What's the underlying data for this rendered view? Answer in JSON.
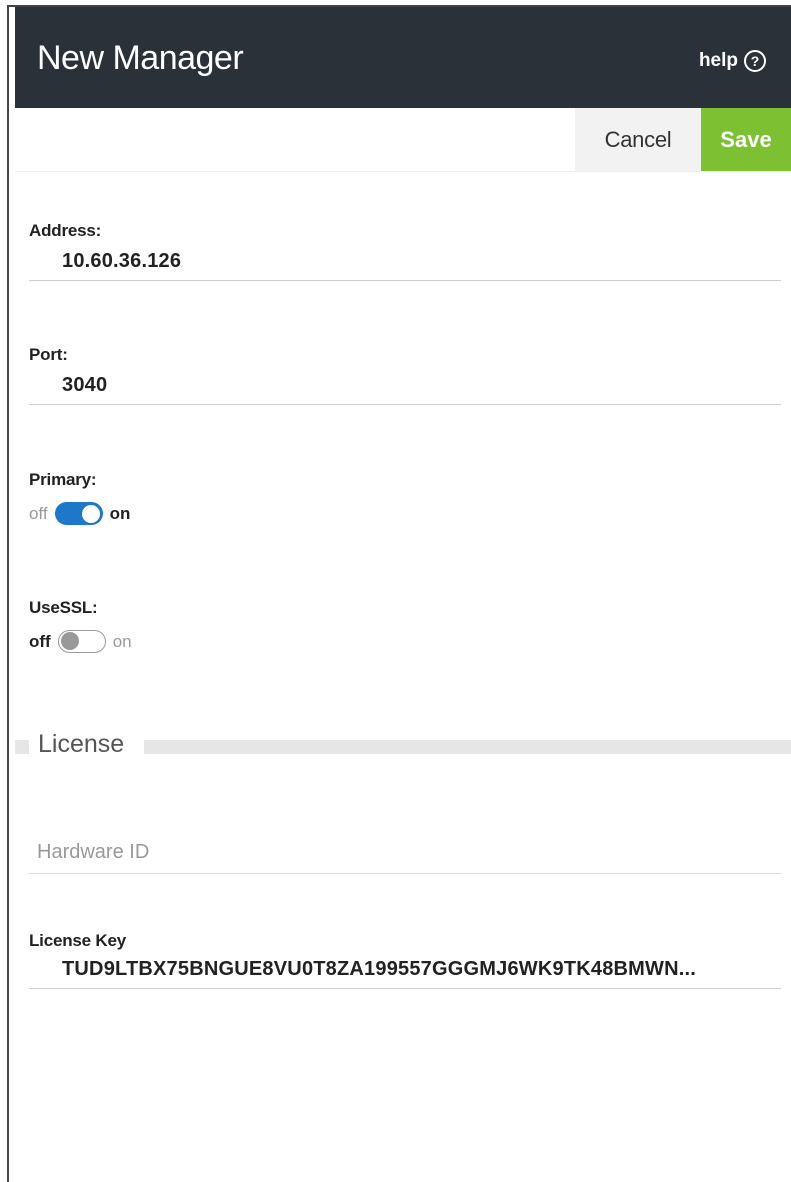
{
  "header": {
    "title": "New Manager",
    "help_label": "help",
    "help_icon": "?"
  },
  "toolbar": {
    "cancel_label": "Cancel",
    "save_label": "Save"
  },
  "fields": {
    "address": {
      "label": "Address:",
      "value": "10.60.36.126"
    },
    "port": {
      "label": "Port:",
      "value": "3040"
    },
    "primary": {
      "label": "Primary:",
      "off_label": "off",
      "on_label": "on",
      "state": "on"
    },
    "usessl": {
      "label": "UseSSL:",
      "off_label": "off",
      "on_label": "on",
      "state": "off"
    }
  },
  "license": {
    "section_title": "License",
    "hardware_id_placeholder": "Hardware ID",
    "license_key_label": "License Key",
    "license_key_value": "TUD9LTBX75BNGUE8VU0T8ZA199557GGGMJ6WK9TK48BMWN..."
  },
  "colors": {
    "header_bg": "#2b3138",
    "save_bg": "#7cc132",
    "toggle_on": "#1e78c8"
  }
}
